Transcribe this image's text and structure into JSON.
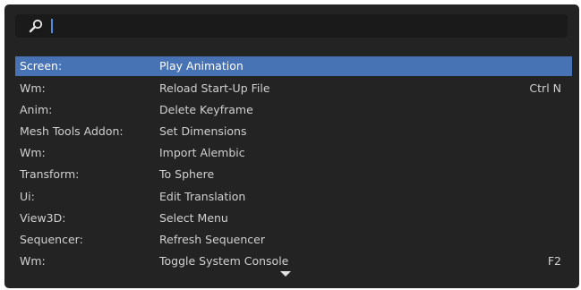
{
  "search": {
    "value": "",
    "placeholder": ""
  },
  "results": [
    {
      "category": "Screen:",
      "name": "Play Animation",
      "shortcut": ""
    },
    {
      "category": "Wm:",
      "name": "Reload Start-Up File",
      "shortcut": "Ctrl N"
    },
    {
      "category": "Anim:",
      "name": "Delete Keyframe",
      "shortcut": ""
    },
    {
      "category": "Mesh Tools Addon:",
      "name": "Set Dimensions",
      "shortcut": ""
    },
    {
      "category": "Wm:",
      "name": "Import Alembic",
      "shortcut": ""
    },
    {
      "category": "Transform:",
      "name": "To Sphere",
      "shortcut": ""
    },
    {
      "category": "Ui:",
      "name": "Edit Translation",
      "shortcut": ""
    },
    {
      "category": "View3D:",
      "name": "Select Menu",
      "shortcut": ""
    },
    {
      "category": "Sequencer:",
      "name": "Refresh Sequencer",
      "shortcut": ""
    },
    {
      "category": "Wm:",
      "name": "Toggle System Console",
      "shortcut": "F2"
    }
  ],
  "icons": {
    "search": "search-icon",
    "scroll_down": "chevron-down-icon"
  },
  "colors": {
    "panel_bg": "#232323",
    "search_bg": "#1a1a1a",
    "highlight": "#4772b3",
    "caret": "#4d8ce0",
    "text": "#d0d0d0"
  }
}
